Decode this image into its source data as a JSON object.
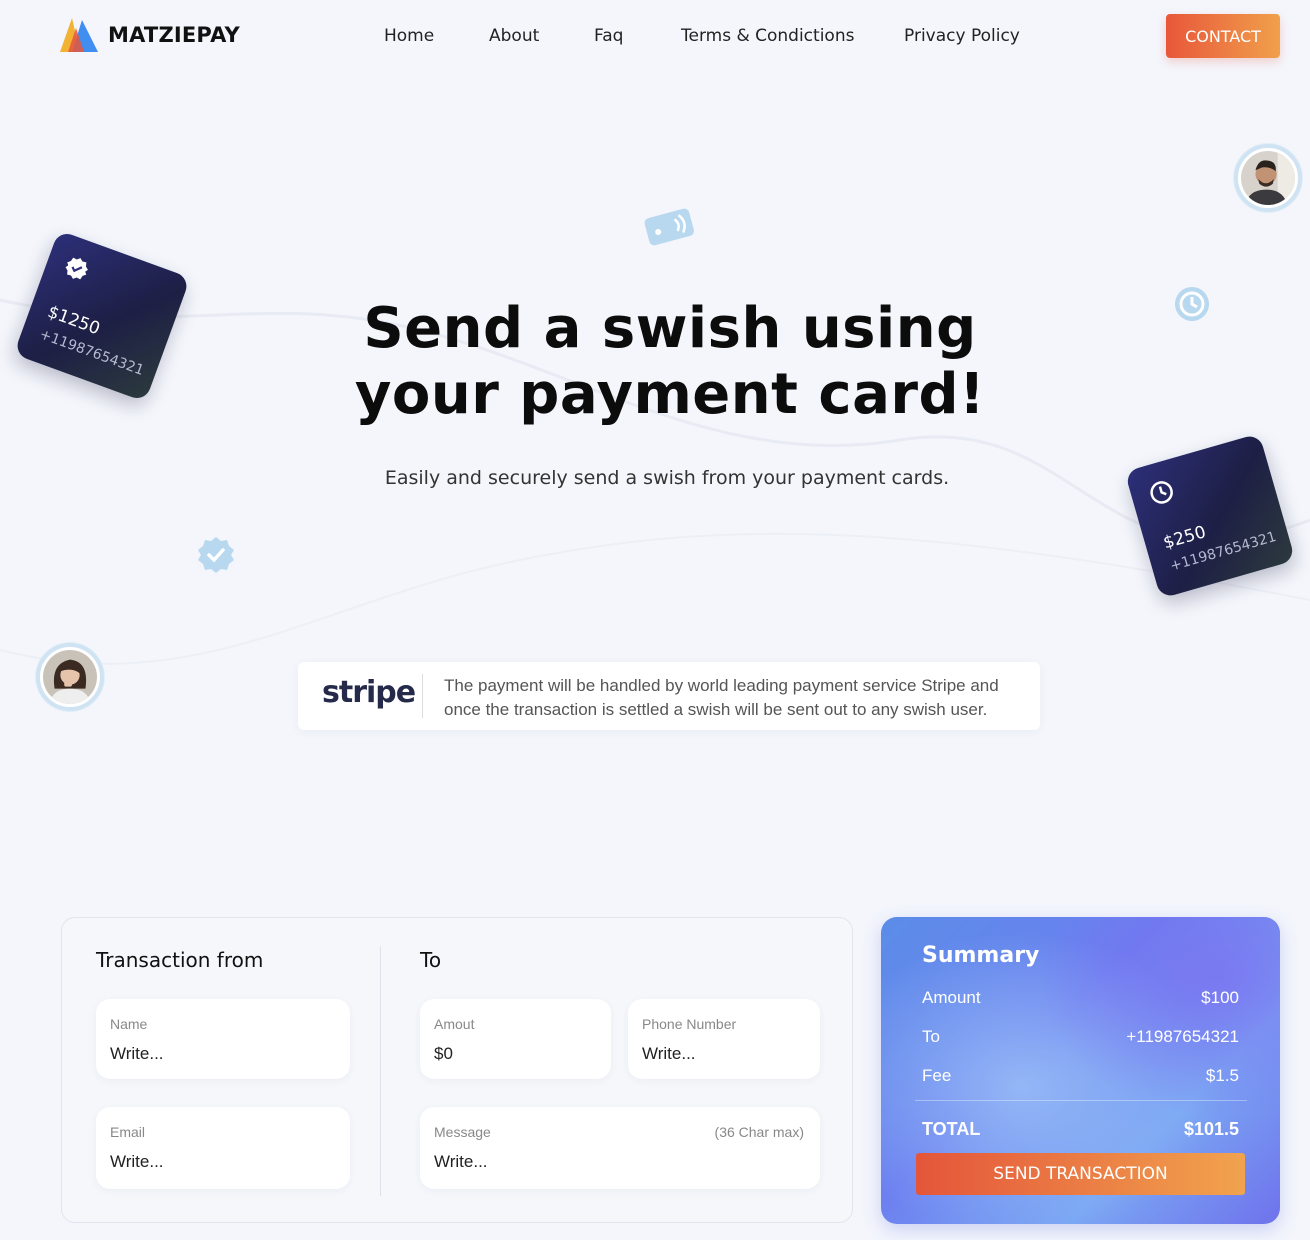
{
  "header": {
    "brand": "MATZIEPAY",
    "nav": [
      "Home",
      "About",
      "Faq",
      "Terms & Condictions",
      "Privacy Policy"
    ],
    "contact_label": "CONTACT"
  },
  "hero": {
    "title_line1": "Send a swish using",
    "title_line2": "your payment card!",
    "subtitle": "Easily and securely send a swish from your payment cards."
  },
  "floating_cards": [
    {
      "amount": "$1250",
      "number": "+11987654321",
      "icon": "verified-icon"
    },
    {
      "amount": "$250",
      "number": "+11987654321",
      "icon": "clock-icon"
    }
  ],
  "stripe": {
    "logo": "stripe",
    "text": "The payment will be handled by world leading payment service Stripe and once the transaction is settled a swish will be sent out to any swish user."
  },
  "form": {
    "from_title": "Transaction from",
    "to_title": "To",
    "name": {
      "label": "Name",
      "placeholder": "Write..."
    },
    "email": {
      "label": "Email",
      "placeholder": "Write..."
    },
    "amount": {
      "label": "Amout",
      "value": "$0"
    },
    "phone": {
      "label": "Phone Number",
      "placeholder": "Write..."
    },
    "message": {
      "label": "Message",
      "hint": "(36 Char max)",
      "placeholder": "Write..."
    }
  },
  "summary": {
    "title": "Summary",
    "rows": [
      {
        "label": "Amount",
        "value": "$100"
      },
      {
        "label": "To",
        "value": "+11987654321"
      },
      {
        "label": "Fee",
        "value": "$1.5"
      }
    ],
    "total_label": "TOTAL",
    "total_value": "$101.5",
    "send_label": "SEND TRANSACTION"
  },
  "colors": {
    "accent_start": "#e8573a",
    "accent_end": "#f0a04b",
    "summary_blue": "#6c7ff0",
    "card_navy": "#1d1f45"
  }
}
